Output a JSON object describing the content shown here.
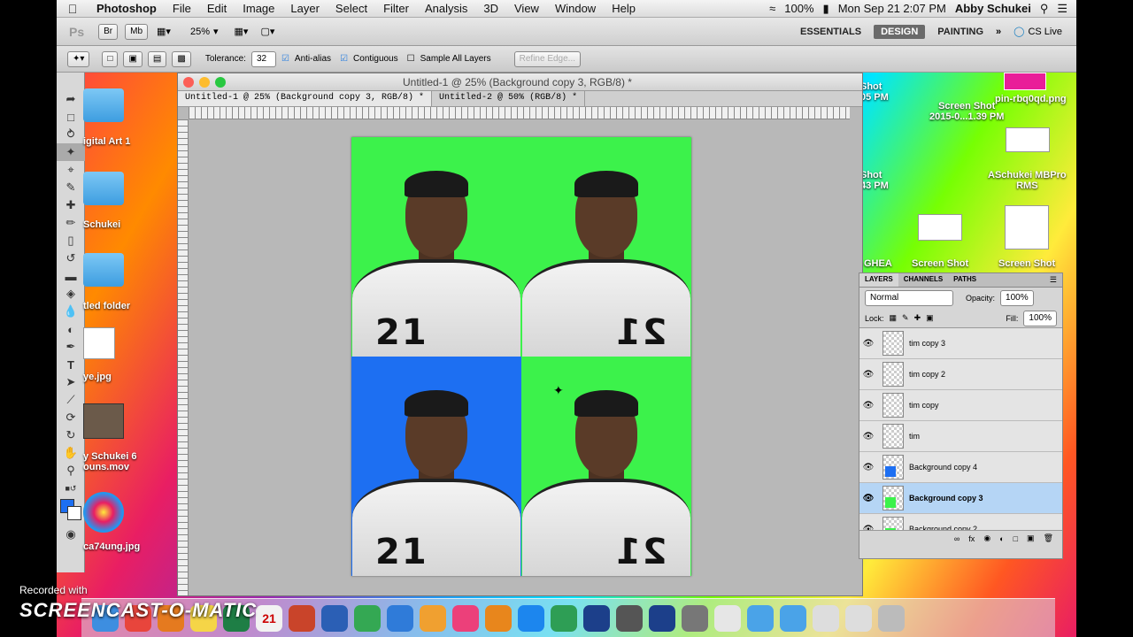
{
  "menubar": {
    "app": "Photoshop",
    "items": [
      "File",
      "Edit",
      "Image",
      "Layer",
      "Select",
      "Filter",
      "Analysis",
      "3D",
      "View",
      "Window",
      "Help"
    ],
    "battery": "100%",
    "clock": "Mon Sep 21  2:07 PM",
    "user": "Abby Schukei"
  },
  "appbar": {
    "zoom": "25%",
    "workspaces": [
      "ESSENTIALS",
      "DESIGN",
      "PAINTING"
    ],
    "active_workspace": "DESIGN",
    "cs_live": "CS Live"
  },
  "options": {
    "tolerance_label": "Tolerance:",
    "tolerance_value": "32",
    "anti_alias": "Anti-alias",
    "contiguous": "Contiguous",
    "sample_all": "Sample All Layers",
    "refine_edge": "Refine Edge..."
  },
  "document": {
    "title": "Untitled-1 @ 25% (Background copy 3, RGB/8) *",
    "tabs": [
      "Untitled-1 @ 25% (Background copy 3, RGB/8) *",
      "Untitled-2 @ 50% (RGB/8) *"
    ],
    "cells": [
      {
        "bg": "#3cf24b",
        "number": "21",
        "mirror": false
      },
      {
        "bg": "#3cf24b",
        "number": "21",
        "mirror": true
      },
      {
        "bg": "#1d6ff2",
        "number": "21",
        "mirror": false
      },
      {
        "bg": "#3cf24b",
        "number": "21",
        "mirror": true
      }
    ]
  },
  "desktop": {
    "left_icons": [
      "igital Art 1",
      "Schukei",
      "tled folder",
      "ye.jpg",
      "y Schukei 6",
      "ouns.mov",
      "ca74ung.jpg"
    ],
    "right_icons": [
      "Shot",
      "05 PM",
      "pin-rbq0qd.png",
      "Screen Shot",
      "2015-0...1.39 PM",
      "Shot",
      "43 PM",
      "ASchukei MBPro",
      "RMS",
      "GHEA",
      "Screen Shot",
      "Screen Shot"
    ]
  },
  "layers_panel": {
    "tabs": [
      "LAYERS",
      "CHANNELS",
      "PATHS"
    ],
    "blend_mode": "Normal",
    "opacity_label": "Opacity:",
    "opacity_value": "100%",
    "lock_label": "Lock:",
    "fill_label": "Fill:",
    "fill_value": "100%",
    "layers": [
      {
        "name": "tim copy 3",
        "selected": false,
        "swatch": ""
      },
      {
        "name": "tim copy 2",
        "selected": false,
        "swatch": ""
      },
      {
        "name": "tim copy",
        "selected": false,
        "swatch": ""
      },
      {
        "name": "tim",
        "selected": false,
        "swatch": ""
      },
      {
        "name": "Background copy 4",
        "selected": false,
        "swatch": "#1d6ff2"
      },
      {
        "name": "Background copy 3",
        "selected": true,
        "swatch": "#3cf24b"
      },
      {
        "name": "Background copy 2",
        "selected": false,
        "swatch": "#3cf24b"
      }
    ]
  },
  "watermark": {
    "line1": "Recorded with",
    "line2": "SCREENCAST-O-MATIC"
  },
  "dock": {
    "icons": [
      "finder-icon",
      "chrome-icon",
      "firefox-icon",
      "notes-icon",
      "excel-icon",
      "calendar-icon",
      "powerpoint-icon",
      "word-icon",
      "numbers-icon",
      "keynote-icon",
      "photos-icon",
      "itunes-icon",
      "ibooks-icon",
      "appstore-icon",
      "maps-icon",
      "photoshop-icon",
      "image-icon",
      "photoshop2-icon",
      "preview-icon",
      "document-icon",
      "folder-icon",
      "folder2-icon",
      "screenshot-icon",
      "screenshot2-icon",
      "trash-icon"
    ],
    "calendar_day": "21"
  },
  "colors": {
    "accent_green": "#3cf24b",
    "accent_blue": "#1d6ff2",
    "selection": "#b5d5f5"
  }
}
